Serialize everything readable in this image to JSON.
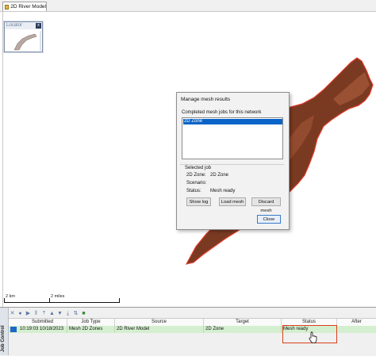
{
  "tab": {
    "title": "2D River Model"
  },
  "locator": {
    "title": "Locator",
    "close_label": "x"
  },
  "scale": {
    "left": "2 km",
    "right": "2 miles"
  },
  "dialog": {
    "title": "Manage mesh results",
    "list_label": "Completed mesh jobs for this network",
    "list_items": [
      "2D Zone"
    ],
    "selected_job_label": "Selected job",
    "zone_label": "2D Zone:",
    "zone_value": "2D Zone",
    "scenario_label": "Scenario:",
    "scenario_value": "",
    "status_label": "Status:",
    "status_value": "Mesh ready",
    "show_log": "Show log",
    "load_mesh": "Load mesh",
    "discard_mesh": "Discard mesh",
    "close": "Close"
  },
  "job_control": {
    "panel_label": "Job Control",
    "columns": [
      "Submitted",
      "Job Type",
      "Source",
      "Target",
      "Status",
      "After"
    ],
    "rows": [
      {
        "submitted": "10:19:03 10/18/2023",
        "job_type": "Mesh 2D Zones",
        "source": "2D River Model",
        "target": "2D Zone",
        "status": "Mesh ready",
        "after": ""
      }
    ]
  },
  "colors": {
    "river_fill": "#7a3a22",
    "river_outline": "#e23a2a",
    "selection": "#0a64c8",
    "row_highlight": "#d4efcf",
    "annotation": "#d9401c"
  },
  "icons": {
    "tab": "model-icon",
    "toolbar": [
      "cancel-icon",
      "refresh-icon",
      "run-icon",
      "pause-icon",
      "move-top-icon",
      "move-up-icon",
      "move-down-icon",
      "move-bottom-icon",
      "dependency-icon",
      "network-icon"
    ]
  }
}
